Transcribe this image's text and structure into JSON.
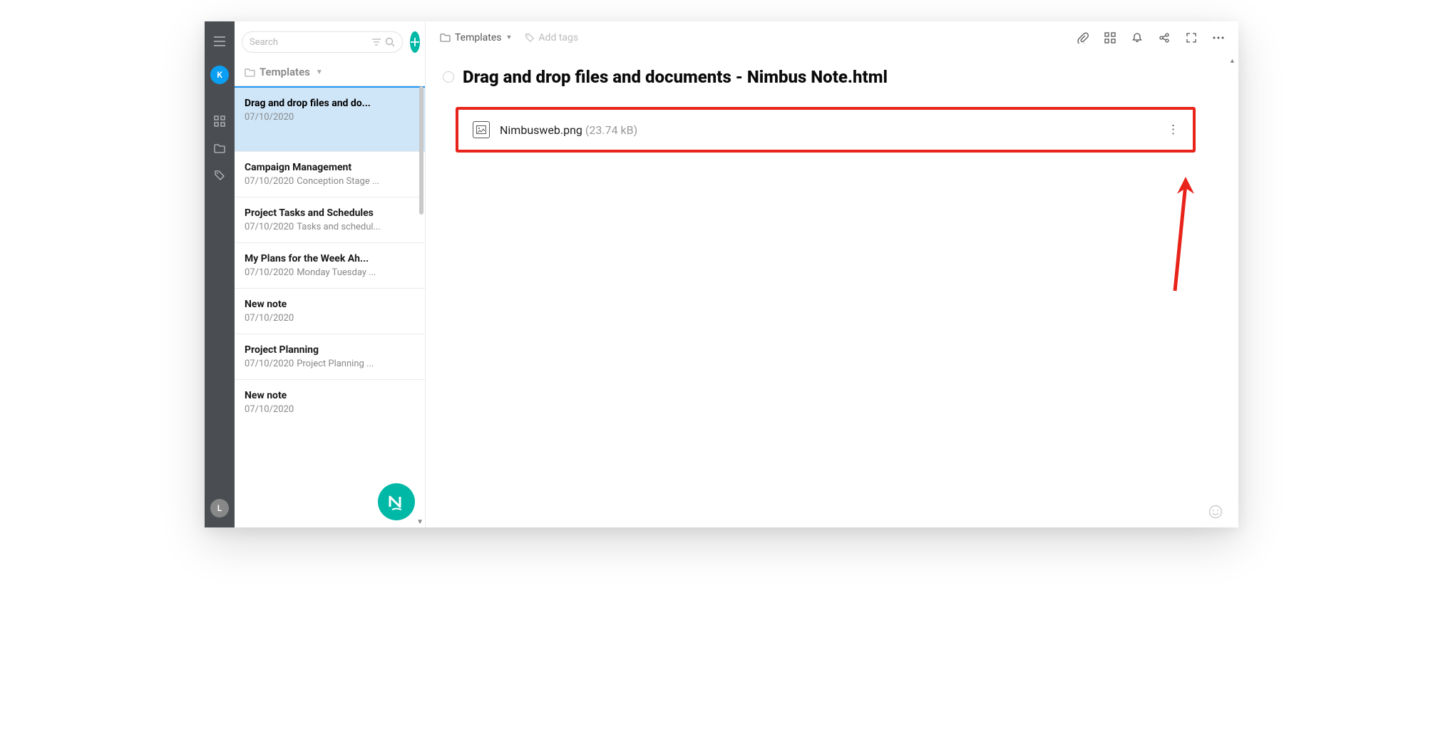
{
  "rail": {
    "avatar_letter": "K",
    "bottom_avatar_letter": "L"
  },
  "search": {
    "placeholder": "Search"
  },
  "list_breadcrumb": {
    "label": "Templates"
  },
  "notes": [
    {
      "title": "Drag and drop files and do...",
      "date": "07/10/2020",
      "excerpt": ""
    },
    {
      "title": "Campaign Management",
      "date": "07/10/2020",
      "excerpt": "Conception Stage ..."
    },
    {
      "title": "Project Tasks and Schedules",
      "date": "07/10/2020",
      "excerpt": "Tasks and schedul..."
    },
    {
      "title": "My Plans for the Week Ah...",
      "date": "07/10/2020",
      "excerpt": "Monday Tuesday ..."
    },
    {
      "title": "New note",
      "date": "07/10/2020",
      "excerpt": ""
    },
    {
      "title": "Project Planning",
      "date": "07/10/2020",
      "excerpt": "Project Planning ..."
    },
    {
      "title": "New note",
      "date": "07/10/2020",
      "excerpt": ""
    }
  ],
  "main": {
    "breadcrumb": "Templates",
    "add_tags": "Add tags",
    "note_title": "Drag and drop files and documents - Nimbus Note.html",
    "attachment": {
      "name": "Nimbusweb.png",
      "size": "(23.74 kB)"
    }
  }
}
